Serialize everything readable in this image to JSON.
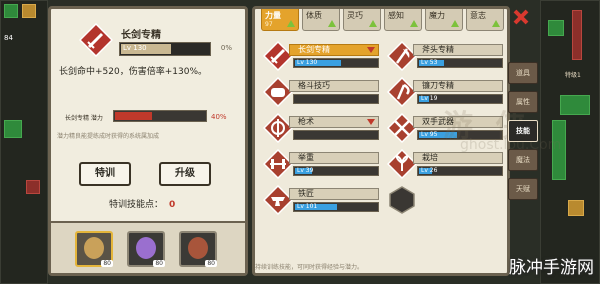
{
  "left_panel": {
    "skill_title": "长剑专精",
    "level_text": "Lv 130",
    "level_pct": "0%",
    "level_fraction": 0.55,
    "description": "长剑命中+520，伤害倍率+130%。",
    "potential_label": "长剑专精 潜力",
    "potential_pct": "40%",
    "potential_fraction": 0.4,
    "hint": "潜力精良能提练成时获得的系统属加成",
    "train_button": "特训",
    "upgrade_button": "升级",
    "points_label": "特训技能点：",
    "points_value": "0",
    "characters": [
      {
        "badge": "80",
        "selected": true,
        "color": "#c9a15a"
      },
      {
        "badge": "80",
        "selected": false,
        "color": "#9a6fcf"
      },
      {
        "badge": "80",
        "selected": false,
        "color": "#a8553b"
      }
    ]
  },
  "tabs": [
    {
      "name": "力量",
      "sub": "97",
      "active": true
    },
    {
      "name": "体质",
      "sub": "",
      "active": false
    },
    {
      "name": "灵巧",
      "sub": "",
      "active": false
    },
    {
      "name": "感知",
      "sub": "",
      "active": false
    },
    {
      "name": "魔力",
      "sub": "",
      "active": false
    },
    {
      "name": "意志",
      "sub": "",
      "active": false
    }
  ],
  "skills": [
    {
      "name": "长剑专精",
      "level": "Lv 130",
      "fill": 0.55,
      "active": true,
      "icon": "sword-icon",
      "col": 0,
      "row": 0,
      "arrow": true
    },
    {
      "name": "斧头专精",
      "level": "Lv 53",
      "fill": 0.3,
      "active": false,
      "icon": "axe-icon",
      "col": 1,
      "row": 0,
      "arrow": false
    },
    {
      "name": "格斗技巧",
      "level": "",
      "fill": 0.0,
      "active": false,
      "icon": "fist-icon",
      "col": 0,
      "row": 1,
      "arrow": false
    },
    {
      "name": "镰刀专精",
      "level": "Lv 19",
      "fill": 0.12,
      "active": false,
      "icon": "scythe-icon",
      "col": 1,
      "row": 1,
      "arrow": false
    },
    {
      "name": "枪术",
      "level": "",
      "fill": 0.0,
      "active": false,
      "icon": "spear-icon",
      "col": 0,
      "row": 2,
      "arrow": true
    },
    {
      "name": "双手武器",
      "level": "Lv 95",
      "fill": 0.45,
      "active": false,
      "icon": "dual-weapon-icon",
      "col": 1,
      "row": 2,
      "arrow": false
    },
    {
      "name": "举重",
      "level": "Lv 39",
      "fill": 0.2,
      "active": false,
      "icon": "weight-icon",
      "col": 0,
      "row": 3,
      "arrow": false
    },
    {
      "name": "栽培",
      "level": "Lv 26",
      "fill": 0.15,
      "active": false,
      "icon": "plant-icon",
      "col": 1,
      "row": 3,
      "arrow": false
    },
    {
      "name": "铁匠",
      "level": "Lv 101",
      "fill": 0.5,
      "active": false,
      "icon": "anvil-icon",
      "col": 0,
      "row": 4,
      "arrow": false
    }
  ],
  "side_nav": [
    {
      "label": "道具",
      "active": false
    },
    {
      "label": "属性",
      "active": false
    },
    {
      "label": "技能",
      "active": true
    },
    {
      "label": "魔法",
      "active": false
    },
    {
      "label": "天赋",
      "active": false
    }
  ],
  "watermark": {
    "mid": "游 侠",
    "url": "ghost.lou.Com",
    "corner": "脉冲手游网"
  },
  "bottom_note": "持续训练技能，可同时获得经验与潜力。",
  "top_right_text": "特级1",
  "coin_text": "84",
  "colors": {
    "accent": "#e4a32c",
    "danger": "#c0392b",
    "exp": "#3aa0e0",
    "panel": "#efeadb"
  }
}
